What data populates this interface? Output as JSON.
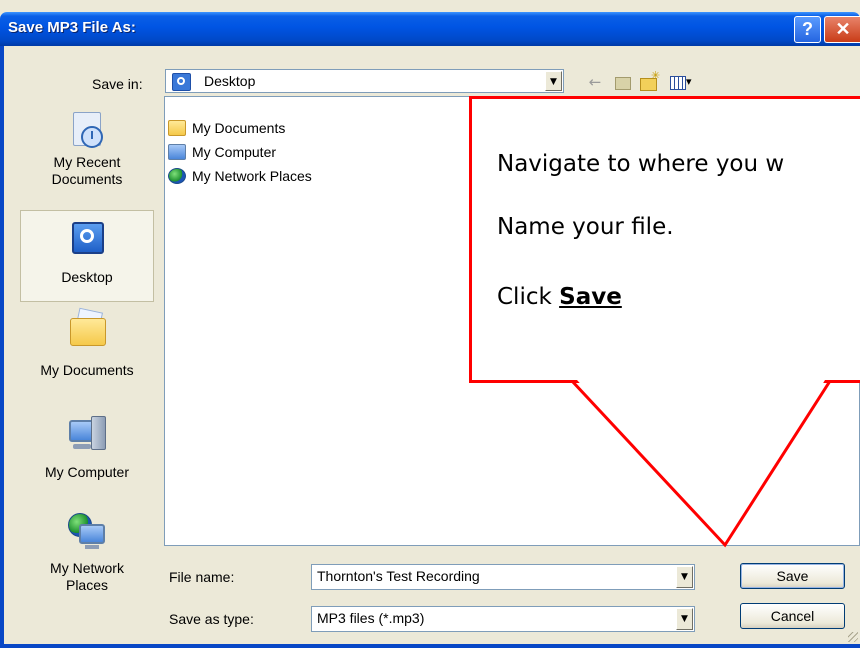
{
  "window": {
    "title": "Save MP3 File As:",
    "help_glyph": "?",
    "close_glyph": "✕"
  },
  "save_in": {
    "label": "Save in:",
    "value": "Desktop",
    "icon": "desktop-icon"
  },
  "toolbar": {
    "back_glyph": "←",
    "icons": [
      "back-icon",
      "up-folder-icon",
      "new-folder-icon",
      "view-menu-icon"
    ]
  },
  "places": [
    {
      "label": "My Recent Documents",
      "line1": "My Recent",
      "line2": "Documents",
      "icon": "recent-documents-icon"
    },
    {
      "label": "Desktop",
      "line1": "Desktop",
      "line2": "",
      "icon": "desktop-icon",
      "selected": true
    },
    {
      "label": "My Documents",
      "line1": "My Documents",
      "line2": "",
      "icon": "my-documents-icon"
    },
    {
      "label": "My Computer",
      "line1": "My Computer",
      "line2": "",
      "icon": "my-computer-icon"
    },
    {
      "label": "My Network Places",
      "line1": "My Network",
      "line2": "Places",
      "icon": "my-network-places-icon"
    }
  ],
  "files": [
    {
      "name": "My Documents",
      "icon": "folder-icon"
    },
    {
      "name": "My Computer",
      "icon": "computer-icon"
    },
    {
      "name": "My Network Places",
      "icon": "network-icon"
    }
  ],
  "callout": {
    "line1": "Navigate to where you w",
    "line2": "Name your file.",
    "line3_prefix": "Click ",
    "line3_bold": "Save",
    "border_color": "#ff0000"
  },
  "file_name": {
    "label": "File name:",
    "value": "Thornton's Test Recording"
  },
  "save_as_type": {
    "label": "Save as type:",
    "value": "MP3 files (*.mp3)"
  },
  "buttons": {
    "save": "Save",
    "cancel": "Cancel"
  },
  "colors": {
    "title_bar": "#0054e3",
    "dialog_bg": "#ece9d8",
    "callout_border": "#ff0000"
  }
}
